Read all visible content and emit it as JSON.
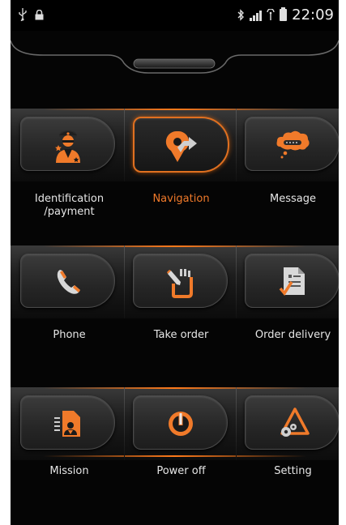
{
  "status_bar": {
    "icons_left": [
      "usb-icon",
      "lock-icon"
    ],
    "icons_right": [
      "bluetooth-icon",
      "signal-icon",
      "wifi-signal-icon",
      "battery-icon"
    ],
    "time": "22:09"
  },
  "menu": {
    "rows": [
      {
        "items": [
          {
            "label": "Identification\n/payment",
            "icon": "identification-icon",
            "active": false
          },
          {
            "label": "Navigation",
            "icon": "navigation-icon",
            "active": true
          },
          {
            "label": "Message",
            "icon": "message-icon",
            "active": false
          }
        ]
      },
      {
        "items": [
          {
            "label": "Phone",
            "icon": "phone-icon",
            "active": false
          },
          {
            "label": "Take order",
            "icon": "take-order-icon",
            "active": false
          },
          {
            "label": "Order delivery",
            "icon": "order-delivery-icon",
            "active": false
          }
        ]
      },
      {
        "items": [
          {
            "label": "Mission",
            "icon": "mission-icon",
            "active": false
          },
          {
            "label": "Power off",
            "icon": "power-off-icon",
            "active": false
          },
          {
            "label": "Setting",
            "icon": "setting-icon",
            "active": false
          }
        ]
      }
    ]
  },
  "colors": {
    "accent": "#f07a2a",
    "background": "#050505",
    "text": "#e6e6e6"
  }
}
